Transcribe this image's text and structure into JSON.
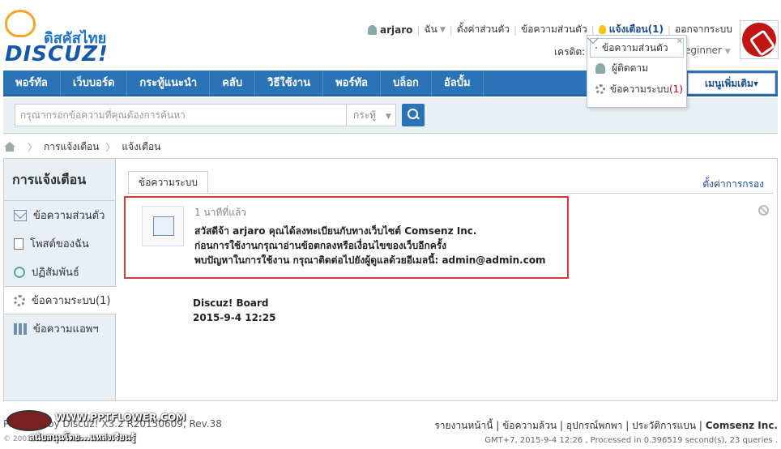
{
  "logo": {
    "thai": "ดิสคัสไทย",
    "word": "DISCUZ!"
  },
  "usermenu": {
    "username": "arjaro",
    "me": "ฉัน",
    "settings": "ตั้งค่าส่วนตัว",
    "pm": "ข้อความส่วนตัว",
    "notice": "แจ้งเตือน(1)",
    "logout": "ออกจากระบบ",
    "credit_label": "เครดิต:",
    "usergroup": "eginner"
  },
  "nav": {
    "items": [
      "พอร์ทัล",
      "เว็บบอร์ด",
      "กระทู้แนะนำ",
      "คลับ",
      "วิธีใช้งาน",
      "พอร์ทัล",
      "บล็อก",
      "อัลบั้ม"
    ],
    "more": "เมนูเพิ่มเติม▾"
  },
  "search": {
    "placeholder": "กรุณากรอกข้อความที่คุณต้องการค้นหา",
    "type": "กระทู้"
  },
  "breadcrumb": {
    "items": [
      "การแจ้งเตือน",
      "แจ้งเตือน"
    ]
  },
  "sidebar": {
    "title": "การแจ้งเตือน",
    "items": [
      {
        "label": "ข้อความส่วนตัว",
        "icon": "mail-icon"
      },
      {
        "label": "โพสต์ของฉัน",
        "icon": "document-icon"
      },
      {
        "label": "ปฏิสัมพันธ์",
        "icon": "recycle-icon"
      },
      {
        "label": "ข้อความระบบ(1)",
        "icon": "gear-icon"
      },
      {
        "label": "ข้อความแอพฯ",
        "icon": "grid-icon"
      }
    ]
  },
  "content": {
    "tab": "ข้อความระบบ",
    "settings_link": "ตั้งค่าการกรอง",
    "message": {
      "time": "1 นาทีที่แล้ว",
      "line1": "สวัสดีจ้า arjaro คุณได้ลงทะเบียนกับทางเว็บไซต์ Comsenz Inc.",
      "line2": "ก่อนการใช้งานกรุณาอ่านข้อตกลงหรือเงื่อนไขของเว็บอีกครั้ง",
      "line3": "พบปัญหาในการใช้งาน กรุณาติดต่อไปยังผู้ดูแลด้วยอีเมลนี้: admin@admin.com"
    },
    "signature": {
      "name": "Discuz! Board",
      "date": "2015-9-4 12:25"
    }
  },
  "dropdown": {
    "items": [
      "ข้อความส่วนตัว",
      "ผู้ติดตาม",
      "ข้อความระบบ",
      "(1)"
    ]
  },
  "footer": {
    "powered": "Powered by Discuz! X3.2 R20150609, Rev.38",
    "copyright": "© 2001-2013 Comsenz Inc.",
    "links": [
      "รายงานหน้านี้",
      "ข้อความล้วน",
      "อุปกรณ์พกพา",
      "ประวัติการแบน"
    ],
    "company": "Comsenz Inc.",
    "gmt": "GMT+7, 2015-9-4 12:26 , Processed in 0.396519 second(s), 23 queries ."
  },
  "watermark": {
    "line1": "WWW.PPTFLOWER.COM",
    "line2": "สนับสนุนโดย...แหล่งเรียนรู้"
  }
}
